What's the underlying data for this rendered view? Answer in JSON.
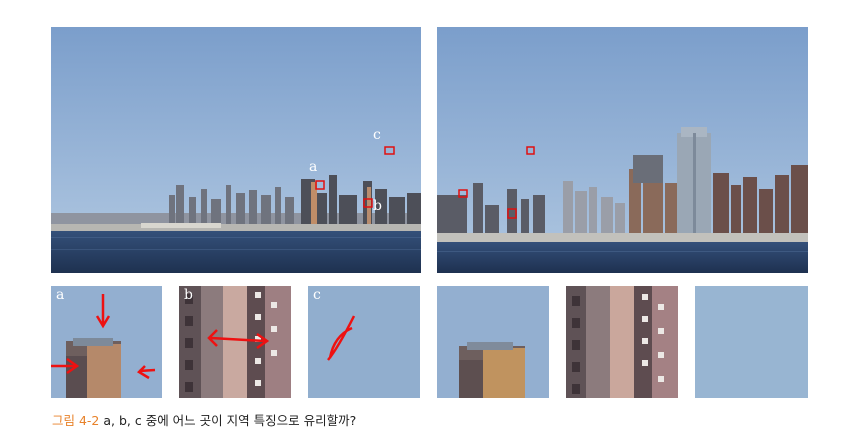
{
  "caption": {
    "figure_label": "그림 4-2",
    "text": " a, b, c 중에 어느 곳이 지역 특징으로 유리할까?"
  },
  "left_photo": {
    "point_labels": {
      "a": "a",
      "b": "b",
      "c": "c"
    }
  },
  "crops": {
    "a_label": "a",
    "b_label": "b",
    "c_label": "c"
  },
  "colors": {
    "sky": "#8cacd2",
    "water": "#243a5a",
    "marker_red": "#e01010",
    "caption_orange": "#e8822a",
    "annotation_red": "#ee1111"
  }
}
